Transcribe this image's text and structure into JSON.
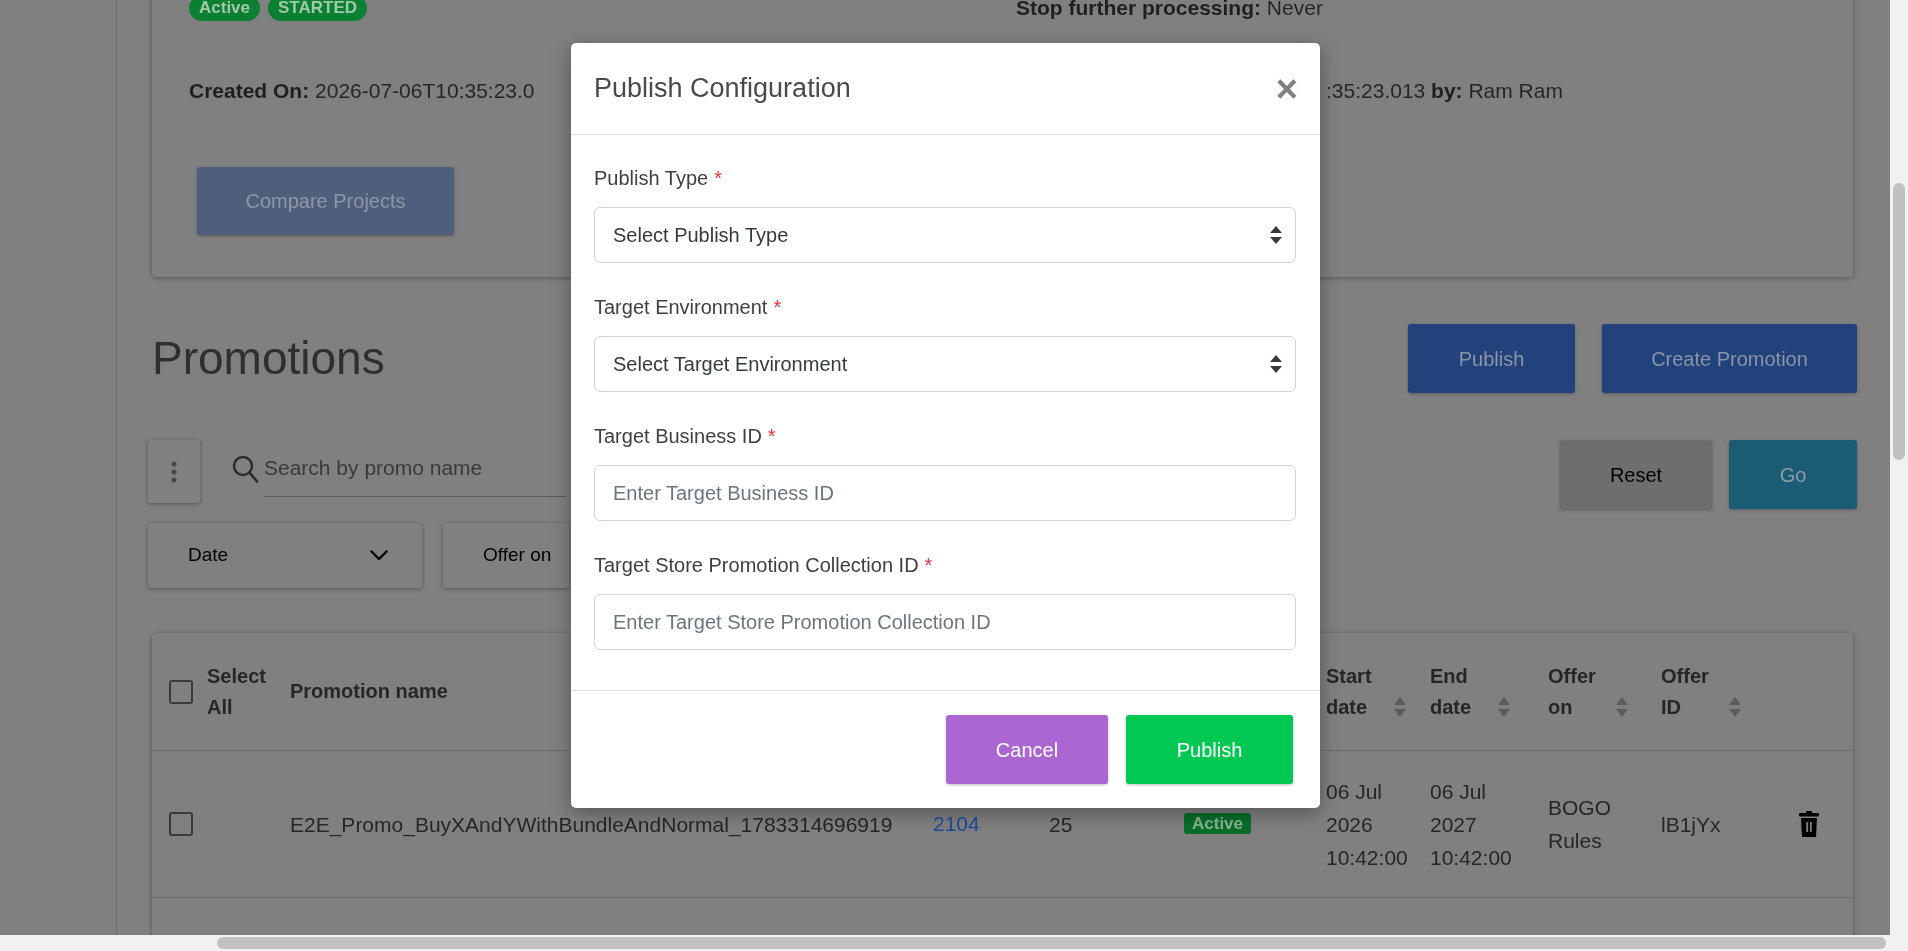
{
  "project_card": {
    "badges": [
      "Active",
      "STARTED"
    ],
    "stop_processing": "**Stop further processing:** Never",
    "created_on": "**Created On:** 2026-07-06T10:35:23.0",
    "updated_on": ":35:23.013 **by:** Ram Ram",
    "compare_button": "Compare Projects"
  },
  "promotions": {
    "title": "Promotions",
    "actions": [
      "Publish",
      "Create Promotion"
    ],
    "search": {
      "placeholder": "Search by promo name"
    },
    "buttons": [
      "Reset",
      "Go"
    ],
    "filters": [
      {
        "label": "Date",
        "caret": true
      },
      {
        "label": "Offer on"
      }
    ]
  },
  "table": {
    "columns": [
      {
        "kind": "select-all",
        "label": "Select All",
        "checked": false
      },
      {
        "kind": "plain",
        "label": "Promotion name"
      },
      {
        "kind": "blank"
      },
      {
        "kind": "blank"
      },
      {
        "kind": "blank"
      },
      {
        "kind": "sortable",
        "label": "Start date"
      },
      {
        "kind": "sortable",
        "label": "End date"
      },
      {
        "kind": "sortable",
        "label": "Offer on"
      },
      {
        "kind": "sortable",
        "label": "Offer ID"
      },
      {
        "kind": "blank"
      }
    ],
    "rows": [
      {
        "cells": [
          {
            "kind": "checkbox",
            "checked": false
          },
          {
            "kind": "text",
            "text": "E2E_Promo_BuyXAndYWithBundleAndNormal_1783314696919"
          },
          {
            "kind": "link",
            "text": "2104"
          },
          {
            "kind": "text",
            "text": "25"
          },
          {
            "kind": "badge",
            "text": "Active"
          },
          {
            "kind": "text",
            "text": "06 Jul 2026 10:42:00"
          },
          {
            "kind": "text",
            "text": "06 Jul 2027 10:42:00"
          },
          {
            "kind": "text",
            "text": "BOGO Rules"
          },
          {
            "kind": "text",
            "text": "lB1jYx"
          },
          {
            "kind": "delete"
          }
        ]
      }
    ]
  },
  "modal": {
    "title": "Publish Configuration",
    "close": "×",
    "fields": [
      {
        "kind": "select",
        "label": "Publish Type",
        "required_mark": "*",
        "value": "Select Publish Type"
      },
      {
        "kind": "select",
        "label": "Target Environment",
        "required_mark": "*",
        "value": "Select Target Environment"
      },
      {
        "kind": "input",
        "label": "Target Business ID",
        "required_mark": "*",
        "placeholder": "Enter Target Business ID"
      },
      {
        "kind": "input",
        "label": "Target Store Promotion Collection ID",
        "required_mark": "*",
        "placeholder": "Enter Target Store Promotion Collection ID"
      }
    ],
    "buttons": [
      {
        "kind": "cancel",
        "label": "Cancel"
      },
      {
        "kind": "confirm",
        "label": "Publish"
      }
    ]
  }
}
